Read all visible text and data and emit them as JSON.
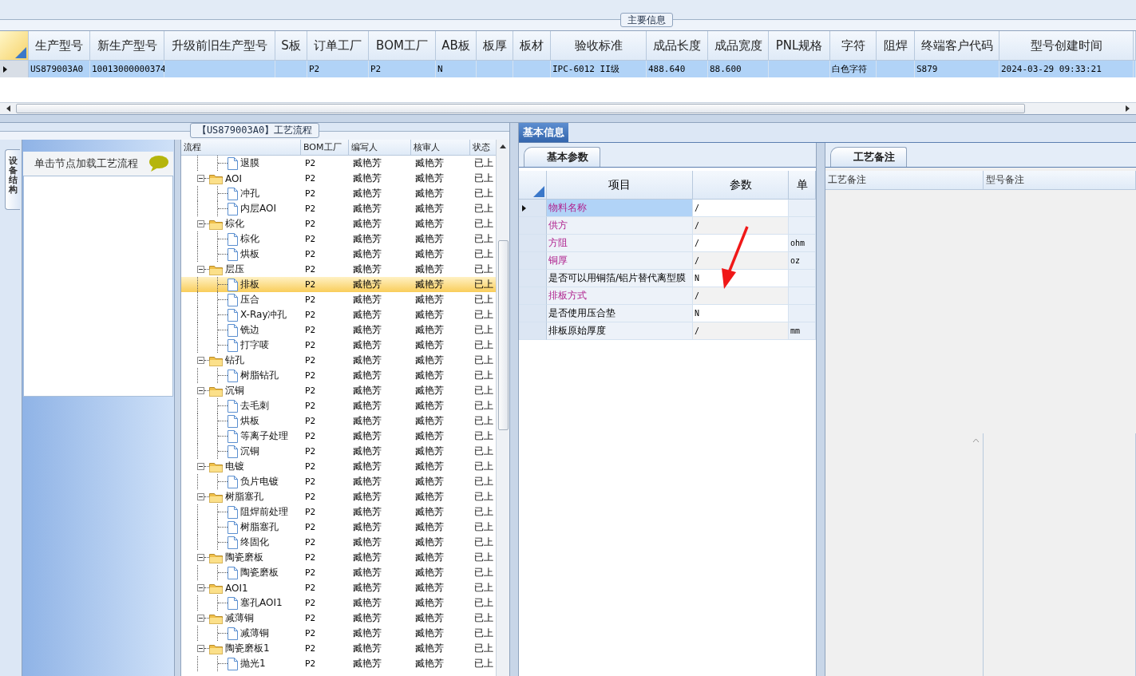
{
  "main_info": {
    "title": "主要信息",
    "columns": [
      "生产型号",
      "新生产型号",
      "升级前旧生产型号",
      "S板",
      "订单工厂",
      "BOM工厂",
      "AB板",
      "板厚",
      "板材",
      "验收标准",
      "成品长度",
      "成品宽度",
      "PNL规格",
      "字符",
      "阻焊",
      "终端客户代码",
      "型号创建时间"
    ],
    "rows": [
      {
        "selected": true,
        "cells": [
          "US879003A0",
          "10013000000374",
          "",
          "",
          "P2",
          "P2",
          "N",
          "",
          "",
          "IPC-6012 II级",
          "488.640",
          "88.600",
          "",
          "白色字符",
          "",
          "S879",
          "2024-03-29 09:33:21"
        ]
      }
    ]
  },
  "process_panel": {
    "title": "【US879003A0】工艺流程",
    "side_tab": "设备结构",
    "hint": "单击节点加载工艺流程",
    "columns": [
      "流程",
      "BOM工厂",
      "编写人",
      "核审人",
      "状态"
    ],
    "tree": [
      {
        "kind": "file",
        "label": "退膜",
        "bom": "P2",
        "author": "臧艳芳",
        "reviewer": "臧艳芳",
        "status": "已上",
        "selected": false
      },
      {
        "kind": "folder",
        "label": "AOI",
        "bom": "P2",
        "author": "臧艳芳",
        "reviewer": "臧艳芳",
        "status": "已上",
        "selected": false,
        "expanded": true,
        "children": [
          {
            "kind": "file",
            "label": "冲孔",
            "bom": "P2",
            "author": "臧艳芳",
            "reviewer": "臧艳芳",
            "status": "已上",
            "selected": false
          },
          {
            "kind": "file",
            "label": "内层AOI",
            "bom": "P2",
            "author": "臧艳芳",
            "reviewer": "臧艳芳",
            "status": "已上",
            "selected": false
          }
        ]
      },
      {
        "kind": "folder",
        "label": "棕化",
        "bom": "P2",
        "author": "臧艳芳",
        "reviewer": "臧艳芳",
        "status": "已上",
        "selected": false,
        "expanded": true,
        "children": [
          {
            "kind": "file",
            "label": "棕化",
            "bom": "P2",
            "author": "臧艳芳",
            "reviewer": "臧艳芳",
            "status": "已上",
            "selected": false
          },
          {
            "kind": "file",
            "label": "烘板",
            "bom": "P2",
            "author": "臧艳芳",
            "reviewer": "臧艳芳",
            "status": "已上",
            "selected": false
          }
        ]
      },
      {
        "kind": "folder",
        "label": "层压",
        "bom": "P2",
        "author": "臧艳芳",
        "reviewer": "臧艳芳",
        "status": "已上",
        "selected": false,
        "expanded": true,
        "children": [
          {
            "kind": "file",
            "label": "排板",
            "bom": "P2",
            "author": "臧艳芳",
            "reviewer": "臧艳芳",
            "status": "已上",
            "selected": true
          },
          {
            "kind": "file",
            "label": "压合",
            "bom": "P2",
            "author": "臧艳芳",
            "reviewer": "臧艳芳",
            "status": "已上",
            "selected": false
          },
          {
            "kind": "file",
            "label": "X-Ray冲孔",
            "bom": "P2",
            "author": "臧艳芳",
            "reviewer": "臧艳芳",
            "status": "已上",
            "selected": false
          },
          {
            "kind": "file",
            "label": "铣边",
            "bom": "P2",
            "author": "臧艳芳",
            "reviewer": "臧艳芳",
            "status": "已上",
            "selected": false
          },
          {
            "kind": "file",
            "label": "打字唛",
            "bom": "P2",
            "author": "臧艳芳",
            "reviewer": "臧艳芳",
            "status": "已上",
            "selected": false
          }
        ]
      },
      {
        "kind": "folder",
        "label": "钻孔",
        "bom": "P2",
        "author": "臧艳芳",
        "reviewer": "臧艳芳",
        "status": "已上",
        "selected": false,
        "expanded": true,
        "children": [
          {
            "kind": "file",
            "label": "树脂钻孔",
            "bom": "P2",
            "author": "臧艳芳",
            "reviewer": "臧艳芳",
            "status": "已上",
            "selected": false
          }
        ]
      },
      {
        "kind": "folder",
        "label": "沉铜",
        "bom": "P2",
        "author": "臧艳芳",
        "reviewer": "臧艳芳",
        "status": "已上",
        "selected": false,
        "expanded": true,
        "children": [
          {
            "kind": "file",
            "label": "去毛刺",
            "bom": "P2",
            "author": "臧艳芳",
            "reviewer": "臧艳芳",
            "status": "已上",
            "selected": false
          },
          {
            "kind": "file",
            "label": "烘板",
            "bom": "P2",
            "author": "臧艳芳",
            "reviewer": "臧艳芳",
            "status": "已上",
            "selected": false
          },
          {
            "kind": "file",
            "label": "等离子处理",
            "bom": "P2",
            "author": "臧艳芳",
            "reviewer": "臧艳芳",
            "status": "已上",
            "selected": false
          },
          {
            "kind": "file",
            "label": "沉铜",
            "bom": "P2",
            "author": "臧艳芳",
            "reviewer": "臧艳芳",
            "status": "已上",
            "selected": false
          }
        ]
      },
      {
        "kind": "folder",
        "label": "电镀",
        "bom": "P2",
        "author": "臧艳芳",
        "reviewer": "臧艳芳",
        "status": "已上",
        "selected": false,
        "expanded": true,
        "children": [
          {
            "kind": "file",
            "label": "负片电镀",
            "bom": "P2",
            "author": "臧艳芳",
            "reviewer": "臧艳芳",
            "status": "已上",
            "selected": false
          }
        ]
      },
      {
        "kind": "folder",
        "label": "树脂塞孔",
        "bom": "P2",
        "author": "臧艳芳",
        "reviewer": "臧艳芳",
        "status": "已上",
        "selected": false,
        "expanded": true,
        "children": [
          {
            "kind": "file",
            "label": "阻焊前处理",
            "bom": "P2",
            "author": "臧艳芳",
            "reviewer": "臧艳芳",
            "status": "已上",
            "selected": false
          },
          {
            "kind": "file",
            "label": "树脂塞孔",
            "bom": "P2",
            "author": "臧艳芳",
            "reviewer": "臧艳芳",
            "status": "已上",
            "selected": false
          },
          {
            "kind": "file",
            "label": "终固化",
            "bom": "P2",
            "author": "臧艳芳",
            "reviewer": "臧艳芳",
            "status": "已上",
            "selected": false
          }
        ]
      },
      {
        "kind": "folder",
        "label": "陶瓷磨板",
        "bom": "P2",
        "author": "臧艳芳",
        "reviewer": "臧艳芳",
        "status": "已上",
        "selected": false,
        "expanded": true,
        "children": [
          {
            "kind": "file",
            "label": "陶瓷磨板",
            "bom": "P2",
            "author": "臧艳芳",
            "reviewer": "臧艳芳",
            "status": "已上",
            "selected": false
          }
        ]
      },
      {
        "kind": "folder",
        "label": "AOI1",
        "bom": "P2",
        "author": "臧艳芳",
        "reviewer": "臧艳芳",
        "status": "已上",
        "selected": false,
        "expanded": true,
        "children": [
          {
            "kind": "file",
            "label": "塞孔AOI1",
            "bom": "P2",
            "author": "臧艳芳",
            "reviewer": "臧艳芳",
            "status": "已上",
            "selected": false
          }
        ]
      },
      {
        "kind": "folder",
        "label": "减薄铜",
        "bom": "P2",
        "author": "臧艳芳",
        "reviewer": "臧艳芳",
        "status": "已上",
        "selected": false,
        "expanded": true,
        "children": [
          {
            "kind": "file",
            "label": "减薄铜",
            "bom": "P2",
            "author": "臧艳芳",
            "reviewer": "臧艳芳",
            "status": "已上",
            "selected": false
          }
        ]
      },
      {
        "kind": "folder",
        "label": "陶瓷磨板1",
        "bom": "P2",
        "author": "臧艳芳",
        "reviewer": "臧艳芳",
        "status": "已上",
        "selected": false,
        "expanded": true,
        "children": [
          {
            "kind": "file",
            "label": "抛光1",
            "bom": "P2",
            "author": "臧艳芳",
            "reviewer": "臧艳芳",
            "status": "已上",
            "selected": false
          }
        ]
      }
    ]
  },
  "info_tabs": [
    {
      "label": "基本信息",
      "selected": true
    }
  ],
  "params": {
    "tab": "基本参数",
    "columns": [
      "项目",
      "参数",
      "单"
    ],
    "rows": [
      {
        "name": "物料名称",
        "value": "/",
        "unit": "",
        "kind": "required",
        "selected": true
      },
      {
        "name": "供方",
        "value": "/",
        "unit": "",
        "kind": "required",
        "selected": false
      },
      {
        "name": "方阻",
        "value": "/",
        "unit": "ohm",
        "kind": "required",
        "selected": false
      },
      {
        "name": "铜厚",
        "value": "/",
        "unit": "oz",
        "kind": "required",
        "selected": false
      },
      {
        "name": "是否可以用铜箔/铝片替代离型膜",
        "value": "N",
        "unit": "",
        "kind": "optional",
        "selected": false
      },
      {
        "name": "排板方式",
        "value": "/",
        "unit": "",
        "kind": "required",
        "selected": false
      },
      {
        "name": "是否使用压合垫",
        "value": "N",
        "unit": "",
        "kind": "optional",
        "selected": false
      },
      {
        "name": "排板原始厚度",
        "value": "/",
        "unit": "mm",
        "kind": "optional",
        "selected": false
      }
    ]
  },
  "notes": {
    "tab": "工艺备注",
    "columns": [
      "工艺备注",
      "型号备注"
    ]
  }
}
